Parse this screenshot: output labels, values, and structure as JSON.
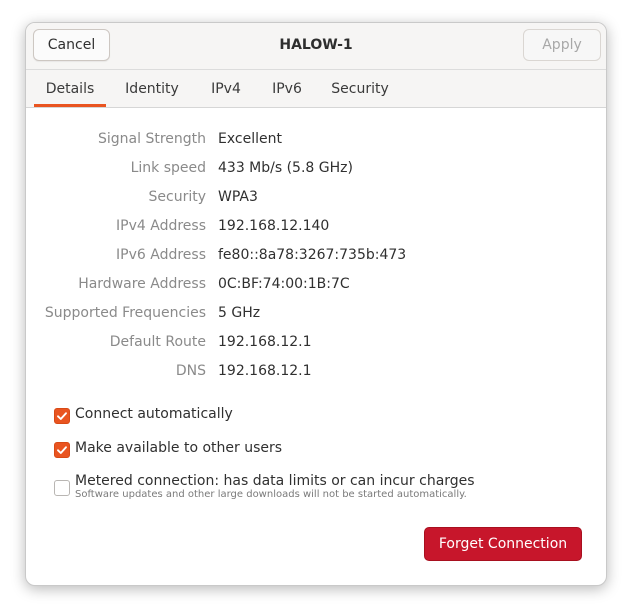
{
  "header": {
    "cancel_label": "Cancel",
    "title": "HALOW-1",
    "apply_label": "Apply"
  },
  "tabs": [
    {
      "label": "Details",
      "active": true
    },
    {
      "label": "Identity",
      "active": false
    },
    {
      "label": "IPv4",
      "active": false
    },
    {
      "label": "IPv6",
      "active": false
    },
    {
      "label": "Security",
      "active": false
    }
  ],
  "details": [
    {
      "label": "Signal Strength",
      "value": "Excellent"
    },
    {
      "label": "Link speed",
      "value": "433 Mb/s (5.8 GHz)"
    },
    {
      "label": "Security",
      "value": "WPA3"
    },
    {
      "label": "IPv4 Address",
      "value": "192.168.12.140"
    },
    {
      "label": "IPv6 Address",
      "value": "fe80::8a78:3267:735b:473"
    },
    {
      "label": "Hardware Address",
      "value": "0C:BF:74:00:1B:7C"
    },
    {
      "label": "Supported Frequencies",
      "value": "5 GHz"
    },
    {
      "label": "Default Route",
      "value": "192.168.12.1"
    },
    {
      "label": "DNS",
      "value": "192.168.12.1"
    }
  ],
  "options": {
    "connect_automatically": {
      "label": "Connect automatically",
      "checked": true
    },
    "available_to_others": {
      "label": "Make available to other users",
      "checked": true
    },
    "metered": {
      "label": "Metered connection: has data limits or can incur charges",
      "sublabel": "Software updates and other large downloads will not be started automatically.",
      "checked": false
    }
  },
  "forget_label": "Forget Connection",
  "colors": {
    "accent": "#e95420",
    "destructive": "#c7162b"
  }
}
